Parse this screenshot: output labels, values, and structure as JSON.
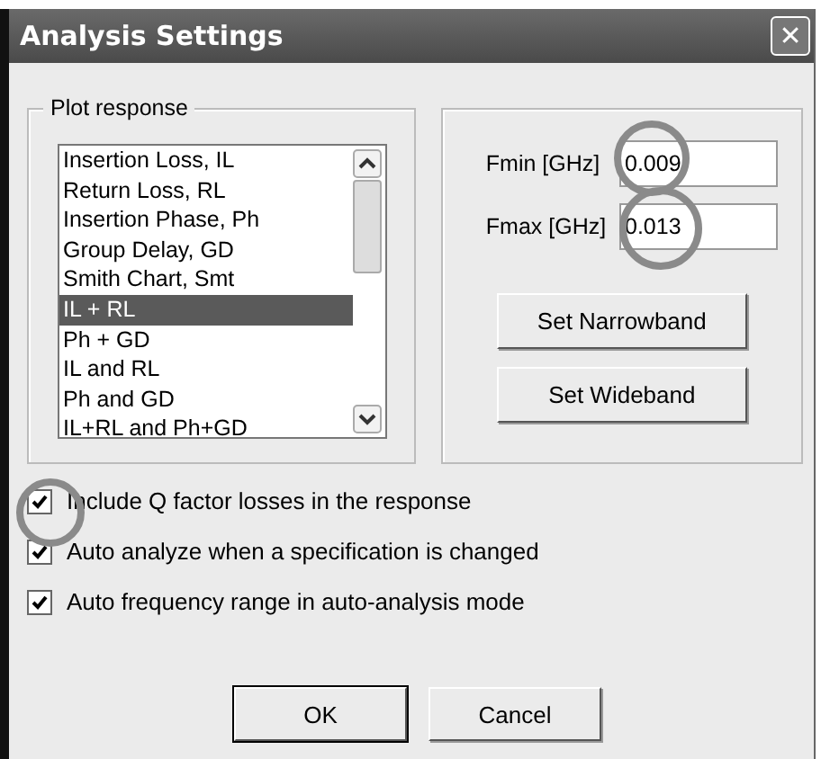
{
  "window": {
    "title": "Analysis Settings",
    "close": "✕"
  },
  "plot_response": {
    "label": "Plot response",
    "items": [
      {
        "label": "Insertion Loss, IL",
        "selected": false
      },
      {
        "label": "Return Loss, RL",
        "selected": false
      },
      {
        "label": "Insertion Phase, Ph",
        "selected": false
      },
      {
        "label": "Group Delay, GD",
        "selected": false
      },
      {
        "label": "Smith Chart, Smt",
        "selected": false
      },
      {
        "label": "IL + RL",
        "selected": true
      },
      {
        "label": "Ph + GD",
        "selected": false
      },
      {
        "label": "IL and RL",
        "selected": false
      },
      {
        "label": "Ph and GD",
        "selected": false
      },
      {
        "label": "IL+RL and Ph+GD",
        "selected": false
      }
    ]
  },
  "frequency": {
    "fields": [
      {
        "label": "Fmin [GHz]",
        "value": "0.009"
      },
      {
        "label": "Fmax [GHz]",
        "value": "0.013"
      }
    ],
    "buttons": [
      "Set Narrowband",
      "Set Wideband"
    ]
  },
  "options": [
    {
      "label": "Include Q factor losses in the response",
      "checked": true
    },
    {
      "label": "Auto analyze when a specification is changed",
      "checked": true
    },
    {
      "label": "Auto frequency range in auto-analysis mode",
      "checked": true
    }
  ],
  "buttons": [
    {
      "label": "OK",
      "default": true
    },
    {
      "label": "Cancel",
      "default": false
    }
  ]
}
